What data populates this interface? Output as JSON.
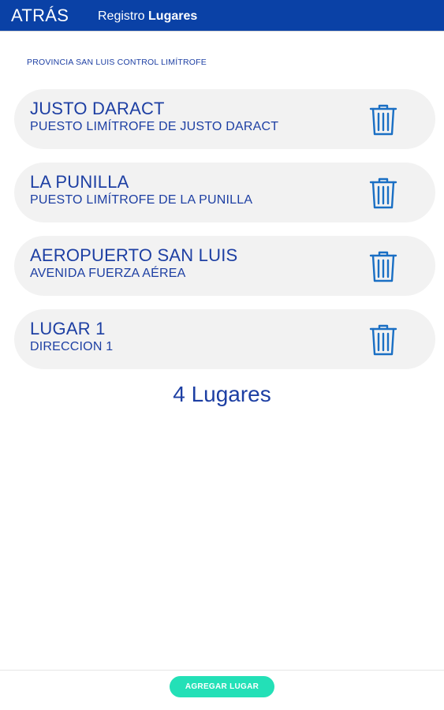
{
  "header": {
    "back_label": "ATRÁS",
    "title_prefix": "Registro",
    "title_strong": "Lugares"
  },
  "section_heading": "PROVINCIA SAN LUIS CONTROL LIMÍTROFE",
  "places": [
    {
      "name": "JUSTO DARACT",
      "address": "PUESTO LIMÍTROFE DE JUSTO DARACT",
      "icon": "trash-icon"
    },
    {
      "name": "LA PUNILLA",
      "address": "PUESTO LIMÍTROFE DE LA PUNILLA",
      "icon": "trash-icon"
    },
    {
      "name": "AEROPUERTO SAN LUIS",
      "address": "AVENIDA FUERZA AÉREA",
      "icon": "trash-icon"
    },
    {
      "name": "LUGAR 1",
      "address": "DIRECCION 1",
      "icon": "trash-icon"
    }
  ],
  "count_label": "4 Lugares",
  "add_button_label": "AGREGAR LUGAR",
  "colors": {
    "header_bg": "#0a41a6",
    "text_blue": "#1d3fa3",
    "icon_blue": "#1a6fc4",
    "card_bg": "#f2f2f2",
    "accent_button": "#23e0b7"
  }
}
